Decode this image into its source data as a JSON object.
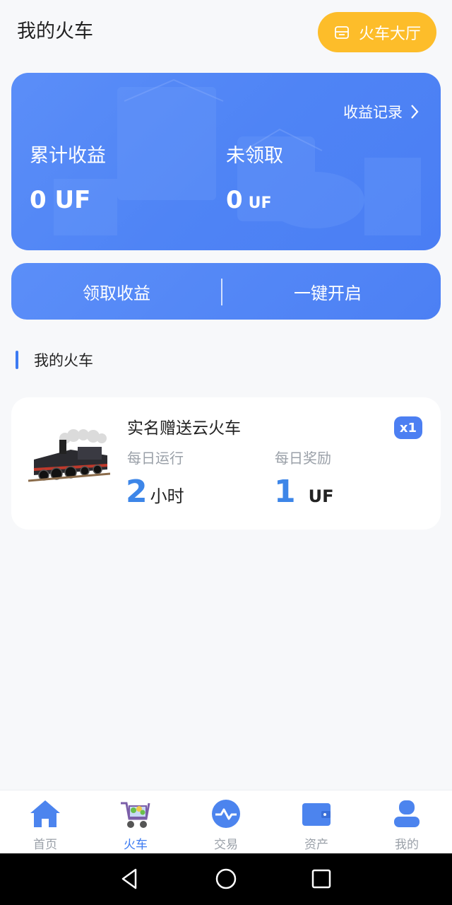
{
  "header": {
    "title": "我的火车",
    "hall_button": "火车大厅",
    "hall_icon": "store-icon"
  },
  "earnings": {
    "record_link": "收益记录",
    "cumulative_label": "累计收益",
    "cumulative_value": "0 UF",
    "unclaimed_label": "未领取",
    "unclaimed_number": "0",
    "unclaimed_unit": "UF"
  },
  "actions": {
    "claim": "领取收益",
    "start_all": "一键开启"
  },
  "section": {
    "title": "我的火车"
  },
  "train": {
    "name": "实名赠送云火车",
    "count_badge": "x1",
    "run_label": "每日运行",
    "run_value": "2",
    "run_unit": "小时",
    "reward_label": "每日奖励",
    "reward_value": "1",
    "reward_unit": "UF"
  },
  "tabs": [
    {
      "label": "首页",
      "icon": "home-icon"
    },
    {
      "label": "火车",
      "icon": "cart-icon",
      "active": true
    },
    {
      "label": "交易",
      "icon": "trade-icon"
    },
    {
      "label": "资产",
      "icon": "wallet-icon"
    },
    {
      "label": "我的",
      "icon": "user-icon"
    }
  ],
  "colors": {
    "accent": "#4c7ff2",
    "hall_button": "#fdbd2a",
    "number": "#3d86e8"
  }
}
